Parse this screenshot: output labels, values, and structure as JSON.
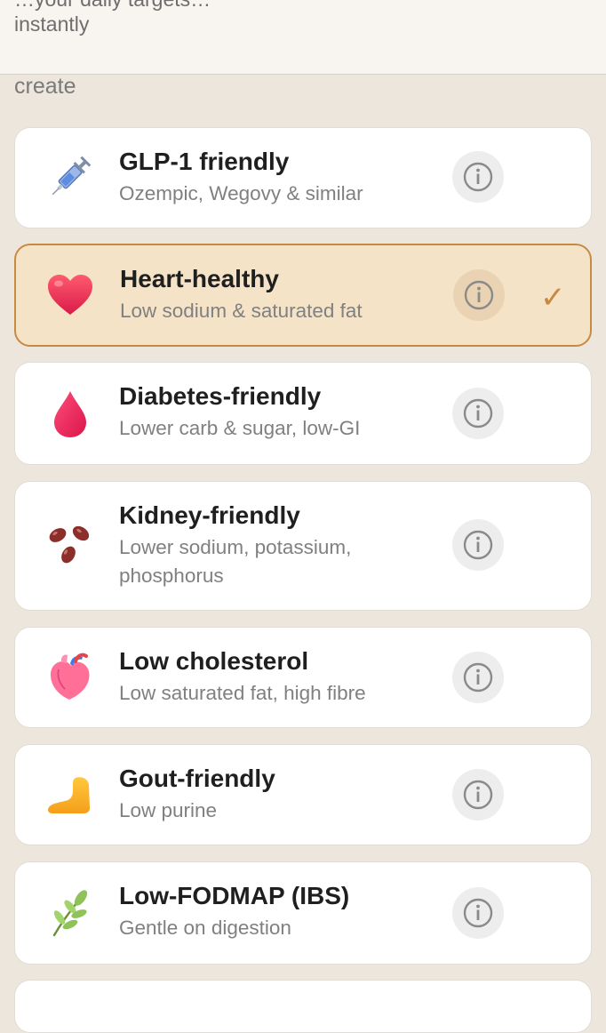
{
  "banner": {
    "cut_text": "…your daily targets…",
    "text": "instantly"
  },
  "section_label": "create",
  "cards": [
    {
      "title": "GLP-1 friendly",
      "subtitle": "Ozempic, Wegovy & similar",
      "icon": "syringe-icon",
      "selected": false
    },
    {
      "title": "Heart-healthy",
      "subtitle": "Low sodium & saturated fat",
      "icon": "red-heart-icon",
      "selected": true,
      "check": "✓"
    },
    {
      "title": "Diabetes-friendly",
      "subtitle": "Lower carb & sugar, low-GI",
      "icon": "drop-of-blood-icon",
      "selected": false
    },
    {
      "title": "Kidney-friendly",
      "subtitle": "Lower sodium, potassium, phosphorus",
      "icon": "beans-icon",
      "selected": false
    },
    {
      "title": "Low cholesterol",
      "subtitle": "Low saturated fat, high fibre",
      "icon": "anatomical-heart-icon",
      "selected": false
    },
    {
      "title": "Gout-friendly",
      "subtitle": "Low purine",
      "icon": "foot-icon",
      "selected": false
    },
    {
      "title": "Low-FODMAP (IBS)",
      "subtitle": "Gentle on digestion",
      "icon": "herb-icon",
      "selected": false
    }
  ],
  "colors": {
    "background": "#ece6dc",
    "card": "#ffffff",
    "selected_card": "#f5e3c7",
    "selected_border": "#c88a43",
    "check": "#c7893f"
  }
}
